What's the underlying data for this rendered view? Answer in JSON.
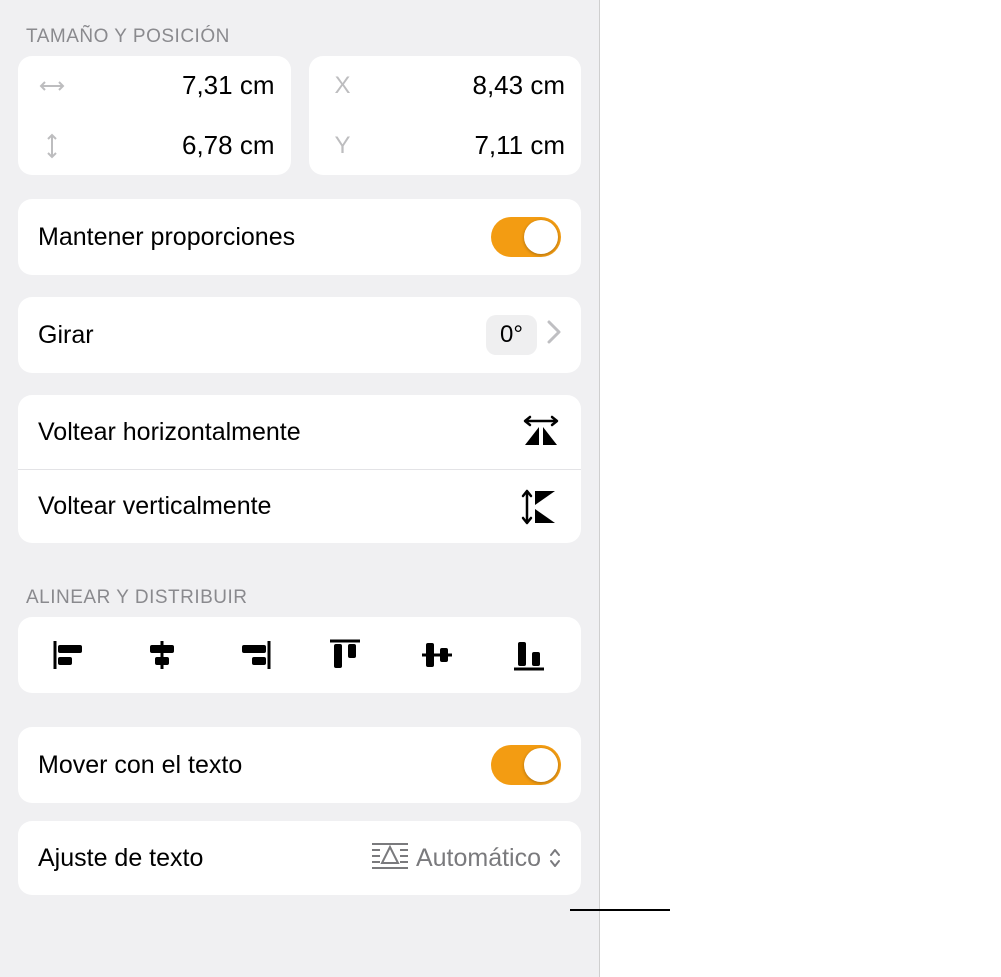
{
  "section_size_pos_title": "Tamaño y Posición",
  "size": {
    "width": "7,31 cm",
    "height": "6,78 cm",
    "x_label": "X",
    "y_label": "Y",
    "x": "8,43 cm",
    "y": "7,11 cm"
  },
  "keep_proportions_label": "Mantener proporciones",
  "rotate_label": "Girar",
  "rotate_value": "0°",
  "flip_h_label": "Voltear horizontalmente",
  "flip_v_label": "Voltear verticalmente",
  "section_align_title": "Alinear y Distribuir",
  "move_with_text_label": "Mover con el texto",
  "text_wrap_label": "Ajuste de texto",
  "text_wrap_value": "Automático"
}
